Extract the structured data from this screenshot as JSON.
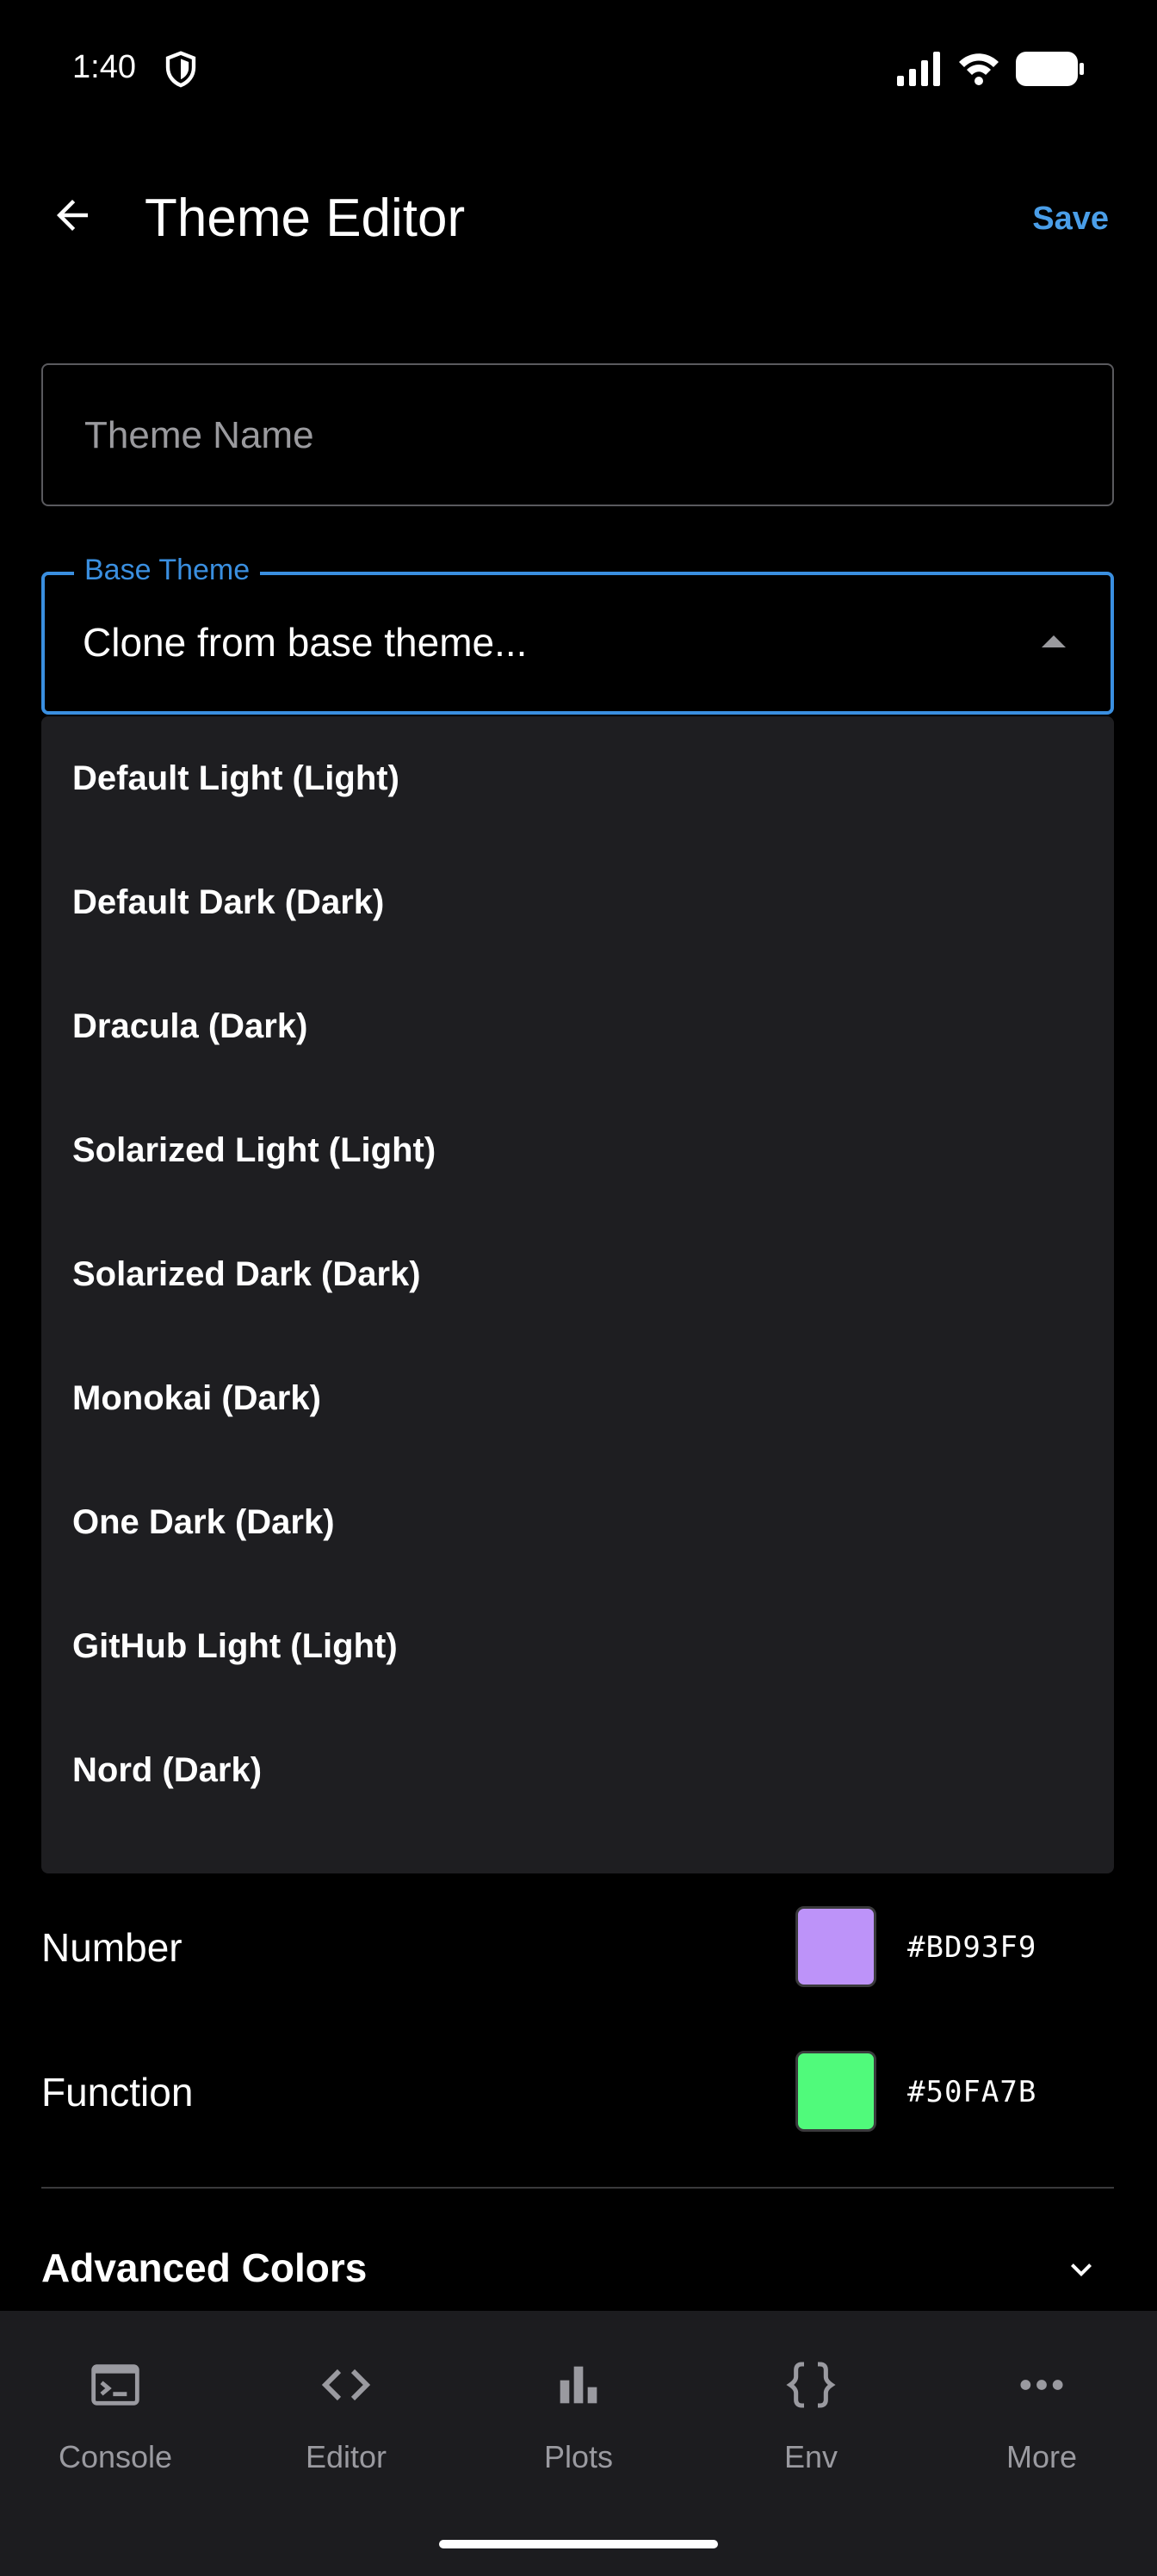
{
  "status_bar": {
    "time": "1:40"
  },
  "app_bar": {
    "title": "Theme Editor",
    "save_label": "Save"
  },
  "theme_name": {
    "placeholder": "Theme Name",
    "value": ""
  },
  "base_theme": {
    "label": "Base Theme",
    "value": "Clone from base theme..."
  },
  "menu": {
    "options": [
      "Default Light (Light)",
      "Default Dark (Dark)",
      "Dracula (Dark)",
      "Solarized Light (Light)",
      "Solarized Dark (Dark)",
      "Monokai (Dark)",
      "One Dark (Dark)",
      "GitHub Light (Light)",
      "Nord (Dark)"
    ]
  },
  "colors": [
    {
      "label": "Number",
      "hex": "#BD93F9"
    },
    {
      "label": "Function",
      "hex": "#50FA7B"
    }
  ],
  "advanced": {
    "title": "Advanced Colors"
  },
  "bottom_nav": {
    "items": [
      {
        "label": "Console",
        "icon": "console-icon"
      },
      {
        "label": "Editor",
        "icon": "code-icon"
      },
      {
        "label": "Plots",
        "icon": "bar-chart-icon"
      },
      {
        "label": "Env",
        "icon": "braces-icon"
      },
      {
        "label": "More",
        "icon": "more-horizontal-icon"
      }
    ]
  },
  "accent_color": "#3a8fe0"
}
